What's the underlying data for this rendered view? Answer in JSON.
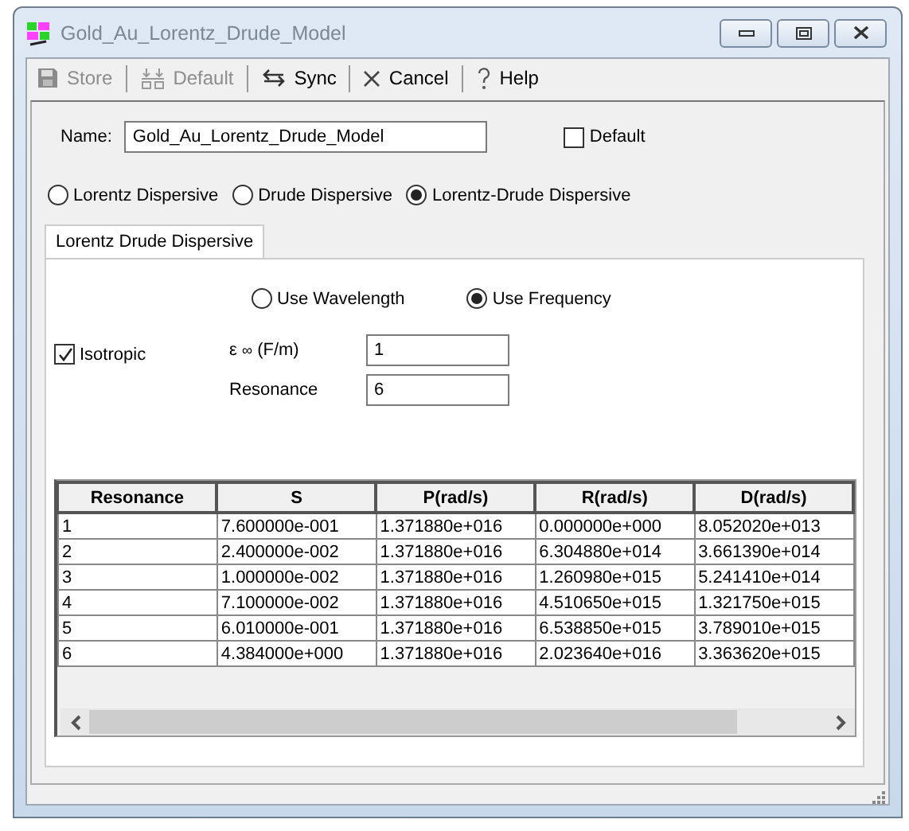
{
  "window": {
    "title": "Gold_Au_Lorentz_Drude_Model"
  },
  "toolbar": [
    {
      "kind": "save",
      "label": "Store",
      "disabled": true
    },
    {
      "kind": "default",
      "label": "Default",
      "disabled": true
    },
    {
      "kind": "sync",
      "label": "Sync",
      "disabled": false
    },
    {
      "kind": "cancel",
      "label": "Cancel",
      "disabled": false
    },
    {
      "kind": "help",
      "label": "Help",
      "disabled": false
    }
  ],
  "name_field": {
    "label": "Name:",
    "value": "Gold_Au_Lorentz_Drude_Model"
  },
  "default_checkbox": {
    "label": "Default",
    "checked": false
  },
  "model_options": [
    {
      "label": "Lorentz Dispersive",
      "selected": false
    },
    {
      "label": "Drude Dispersive",
      "selected": false
    },
    {
      "label": "Lorentz-Drude Dispersive",
      "selected": true
    }
  ],
  "tabs": [
    {
      "label": "Lorentz Drude Dispersive",
      "selected": true
    }
  ],
  "unit_options": [
    {
      "label": "Use Wavelength",
      "selected": false
    },
    {
      "label": "Use Frequency",
      "selected": true
    }
  ],
  "isotropic": {
    "label": "Isotropic",
    "checked": true
  },
  "eps_inf": {
    "symbol": "ε",
    "sub": "∞",
    "unit": "(F/m)",
    "value": "1"
  },
  "resonance_field": {
    "label": "Resonance",
    "value": "6"
  },
  "table": {
    "columns": [
      "Resonance",
      "S",
      "P(rad/s)",
      "R(rad/s)",
      "D(rad/s)"
    ],
    "rows": [
      [
        "1",
        "7.600000e-001",
        "1.371880e+016",
        "0.000000e+000",
        "8.052020e+013"
      ],
      [
        "2",
        "2.400000e-002",
        "1.371880e+016",
        "6.304880e+014",
        "3.661390e+014"
      ],
      [
        "3",
        "1.000000e-002",
        "1.371880e+016",
        "1.260980e+015",
        "5.241410e+014"
      ],
      [
        "4",
        "7.100000e-002",
        "1.371880e+016",
        "4.510650e+015",
        "1.321750e+015"
      ],
      [
        "5",
        "6.010000e-001",
        "1.371880e+016",
        "6.538850e+015",
        "3.789010e+015"
      ],
      [
        "6",
        "4.384000e+000",
        "1.371880e+016",
        "2.023640e+016",
        "3.363620e+015"
      ]
    ]
  }
}
